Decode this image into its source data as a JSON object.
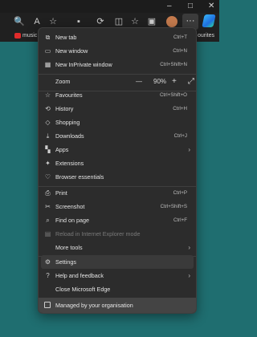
{
  "tabbar": {
    "minimize": "–",
    "maximize": "□",
    "close": "✕"
  },
  "toolbar": {
    "more_label": "···"
  },
  "favourites_bar": {
    "items": [
      "music",
      "ourites"
    ]
  },
  "menu": {
    "new_tab": {
      "label": "New tab",
      "shortcut": "Ctrl+T"
    },
    "new_window": {
      "label": "New window",
      "shortcut": "Ctrl+N"
    },
    "new_inprivate": {
      "label": "New InPrivate window",
      "shortcut": "Ctrl+Shift+N"
    },
    "zoom": {
      "label": "Zoom",
      "minus": "—",
      "value": "90%",
      "plus": "+",
      "fullscreen": "⤢"
    },
    "favourites": {
      "label": "Favourites",
      "shortcut": "Ctrl+Shift+O"
    },
    "history": {
      "label": "History",
      "shortcut": "Ctrl+H"
    },
    "shopping": {
      "label": "Shopping"
    },
    "downloads": {
      "label": "Downloads",
      "shortcut": "Ctrl+J"
    },
    "apps": {
      "label": "Apps"
    },
    "extensions": {
      "label": "Extensions"
    },
    "browser_essentials": {
      "label": "Browser essentials"
    },
    "print": {
      "label": "Print",
      "shortcut": "Ctrl+P"
    },
    "screenshot": {
      "label": "Screenshot",
      "shortcut": "Ctrl+Shift+S"
    },
    "find_on_page": {
      "label": "Find on page",
      "shortcut": "Ctrl+F"
    },
    "reload_ie": {
      "label": "Reload in Internet Explorer mode"
    },
    "more_tools": {
      "label": "More tools"
    },
    "settings": {
      "label": "Settings"
    },
    "help_feedback": {
      "label": "Help and feedback"
    },
    "close_edge": {
      "label": "Close Microsoft Edge"
    },
    "managed": {
      "label": "Managed by your organisation"
    }
  },
  "colors": {
    "accent": "#1f6e70",
    "menu_bg": "#2c2c2c",
    "highlight": "#3a3a3a"
  }
}
